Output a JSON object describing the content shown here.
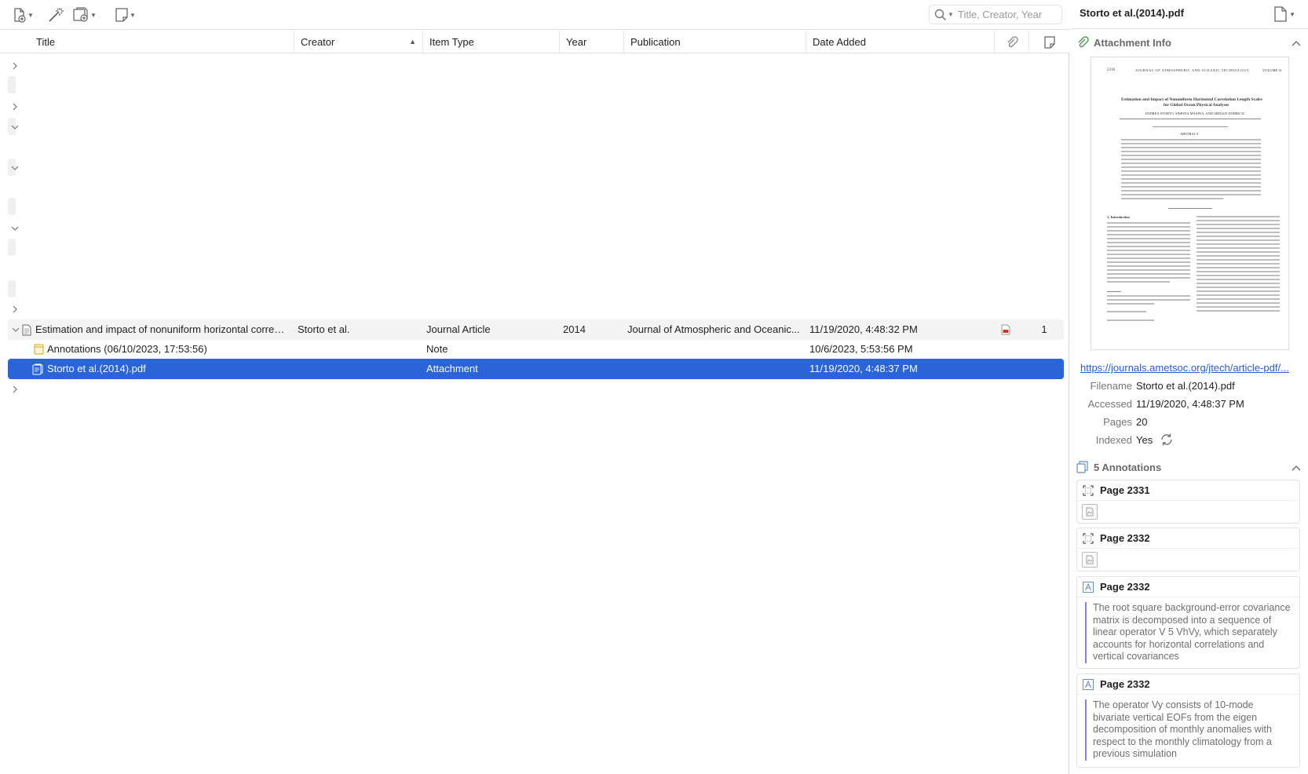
{
  "toolbar": {
    "new_item_icon": "new-item-icon",
    "magic_wand_icon": "add-by-identifier-icon",
    "add_attachment_icon": "add-attachment-icon",
    "new_note_icon": "new-note-icon",
    "search_placeholder": "Title, Creator, Year"
  },
  "columns": {
    "title": "Title",
    "creator": "Creator",
    "item_type": "Item Type",
    "year": "Year",
    "publication": "Publication",
    "date_added": "Date Added"
  },
  "items": {
    "parent": {
      "title": "Estimation and impact of nonuniform horizontal correla...",
      "creator": "Storto et al.",
      "item_type": "Journal Article",
      "year": "2014",
      "publication": "Journal of Atmospheric and Oceanic...",
      "date_added": "11/19/2020, 4:48:32 PM",
      "notes_count": "1"
    },
    "note": {
      "title": "Annotations (06/10/2023, 17:53:56)",
      "item_type": "Note",
      "date_added": "10/6/2023, 5:53:56 PM"
    },
    "attachment": {
      "title": "Storto et al.(2014).pdf",
      "item_type": "Attachment",
      "date_added": "11/19/2020, 4:48:37 PM"
    }
  },
  "pane": {
    "title": "Storto et al.(2014).pdf",
    "attachment_info_label": "Attachment Info",
    "preview": {
      "page_no": "2316",
      "journal": "JOURNAL OF ATMOSPHERIC AND OCEANIC TECHNOLOGY",
      "volume": "VOLUME 31",
      "paper_title_1": "Estimation and Impact of Nonuniform Horizontal Correlation Length Scales",
      "paper_title_2": "for Global Ocean Physical Analyses",
      "authors": "ANDREA STORTO, SIMONA MASINA, AND SRDJAN DOBRICIC",
      "abstract_label": "ABSTRACT",
      "intro_label": "1. Introduction"
    },
    "url": "https://journals.ametsoc.org/jtech/article-pdf/...",
    "fields": {
      "filename_label": "Filename",
      "filename": "Storto et al.(2014).pdf",
      "accessed_label": "Accessed",
      "accessed": "11/19/2020, 4:48:37 PM",
      "pages_label": "Pages",
      "pages": "20",
      "indexed_label": "Indexed",
      "indexed": "Yes"
    },
    "annotations_label": "5 Annotations",
    "annotations": [
      {
        "page": "Page 2331",
        "kind": "image"
      },
      {
        "page": "Page 2332",
        "kind": "image"
      },
      {
        "page": "Page 2332",
        "kind": "text",
        "text": "The root square background-error covariance matrix is decomposed into a sequence of linear operator V 5 VhVy, which separately accounts for horizontal correlations and vertical covariances"
      },
      {
        "page": "Page 2332",
        "kind": "text",
        "text": "The operator Vy consists of 10-mode bivariate vertical EOFs from the eigen decomposition of monthly anomalies with respect to the monthly climatology from a previous simulation"
      }
    ]
  },
  "colors": {
    "selection": "#2b63d9",
    "link": "#2a5bd7",
    "annotation_bar": "#8b7cf6",
    "pdf_red": "#d9332a"
  }
}
